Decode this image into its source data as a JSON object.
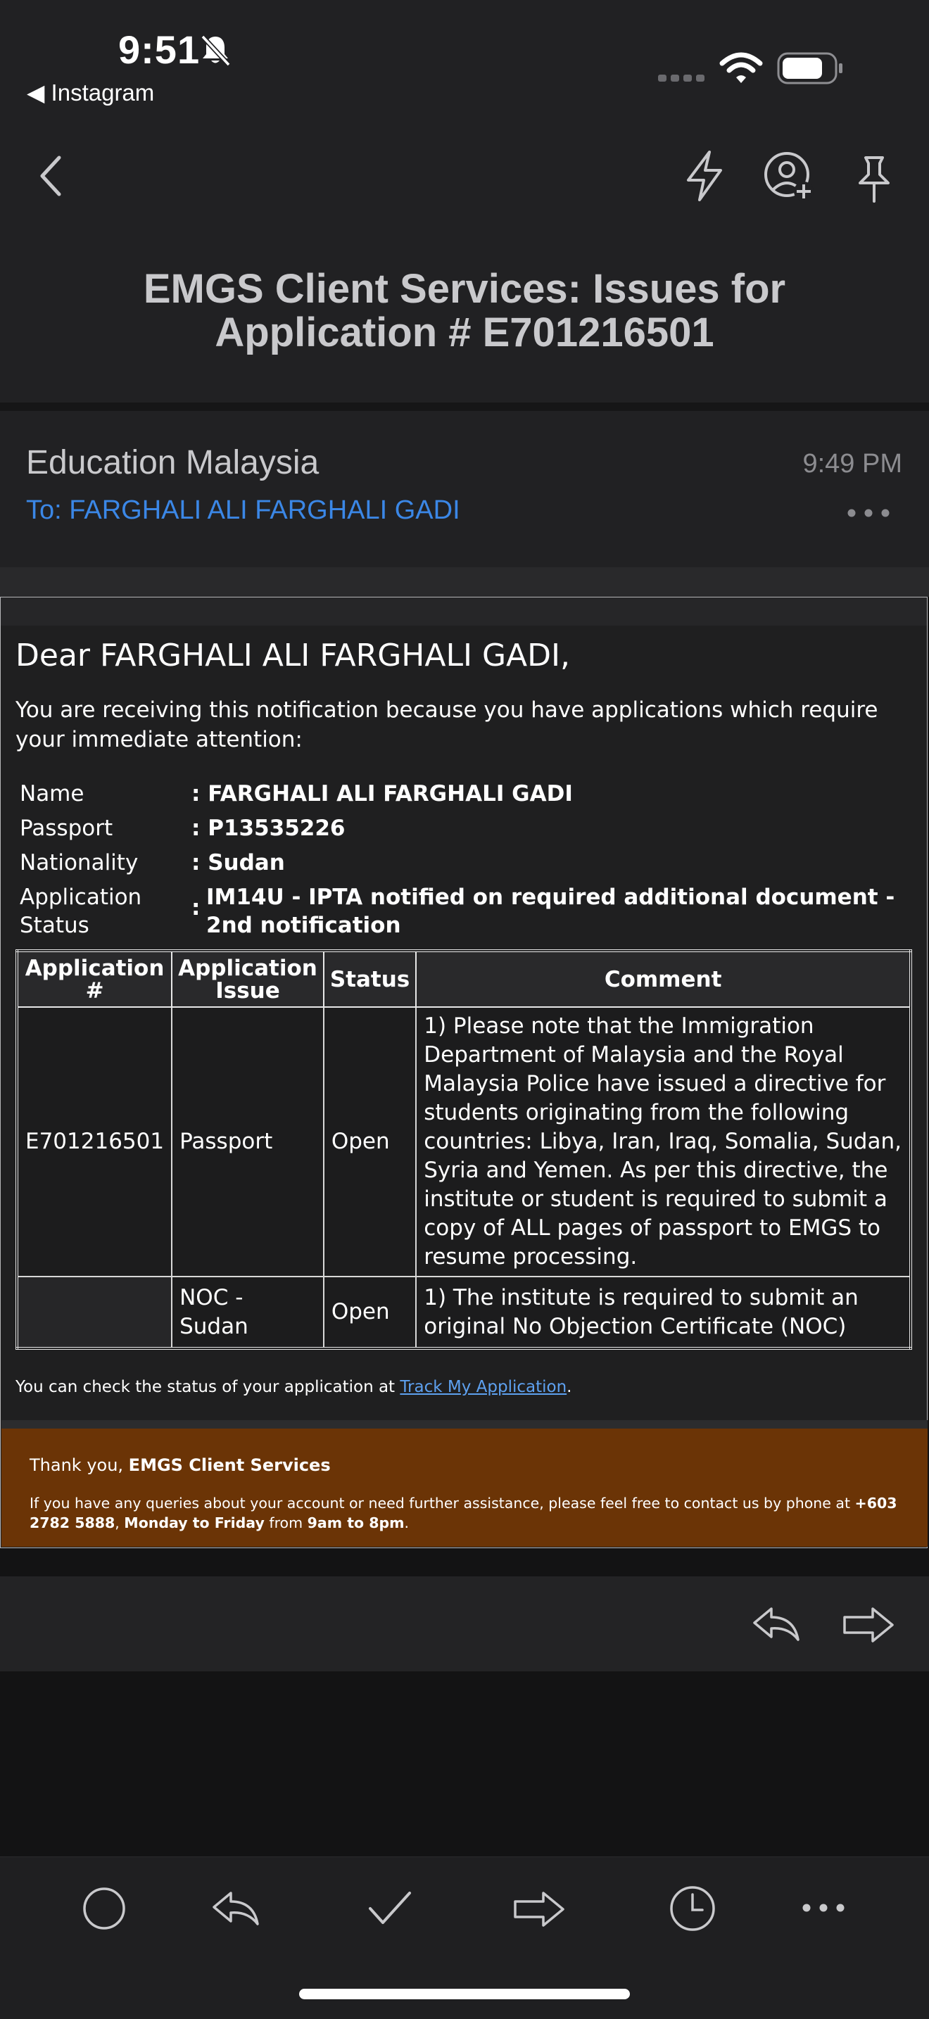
{
  "status_bar": {
    "time": "9:51",
    "back_app": "◀ Instagram"
  },
  "header": {
    "subject": "EMGS Client Services: Issues for Application # E701216501"
  },
  "message": {
    "sender": "Education Malaysia",
    "time": "9:49 PM",
    "to": "To: FARGHALI ALI FARGHALI GADI"
  },
  "email": {
    "greeting": "Dear FARGHALI ALI FARGHALI GADI,",
    "intro": "You are receiving this notification because you have applications which require your immediate attention:",
    "info": [
      {
        "label": "Name",
        "value": ": FARGHALI ALI FARGHALI GADI"
      },
      {
        "label": "Passport",
        "value": ": P13535226"
      },
      {
        "label": "Nationality",
        "value": ": Sudan"
      },
      {
        "label": "Application Status",
        "value": "IM14U - IPTA notified on required additional document - 2nd notification"
      }
    ],
    "table": {
      "headers": [
        "Application #",
        "Application Issue",
        "Status",
        "Comment"
      ],
      "rows": [
        {
          "app": "E701216501",
          "issue": "Passport",
          "status": "Open",
          "comment": "1) Please note that the Immigration Department of Malaysia and the Royal Malaysia Police have issued a directive for students originating from the following countries: Libya, Iran, Iraq, Somalia, Sudan, Syria and Yemen. As per this directive, the institute or student is required to submit a copy of ALL pages of passport to EMGS to resume processing."
        },
        {
          "app": "",
          "issue": "NOC - Sudan",
          "status": "Open",
          "comment": "1) The institute is required to submit an original No Objection Certificate (NOC)"
        }
      ]
    },
    "check_prefix": "You can check the status of your application at ",
    "check_link": "Track My Application",
    "check_suffix": ".",
    "footer": {
      "thanks_prefix": "Thank you, ",
      "thanks_bold": "EMGS Client Services",
      "q1": "If you have any queries about your account or need further assistance, please feel free to contact us by phone at ",
      "phone": "+603 2782 5888",
      "q2": ", ",
      "days": "Monday to Friday",
      "q3": " from ",
      "hours": "9am to 8pm",
      "q4": "."
    }
  },
  "icons": {
    "nav_back": "chevron-left-icon",
    "quick_reply": "lightning-icon",
    "add_contact": "person-add-icon",
    "pin": "pin-icon",
    "reply": "reply-icon",
    "forward": "forward-icon",
    "toolbar": [
      "circle-icon",
      "reply-icon",
      "checkmark-icon",
      "forward-icon",
      "clock-icon",
      "more-icon"
    ]
  },
  "colors": {
    "link": "#3b87e6",
    "footer_bg": "#6b3406"
  }
}
